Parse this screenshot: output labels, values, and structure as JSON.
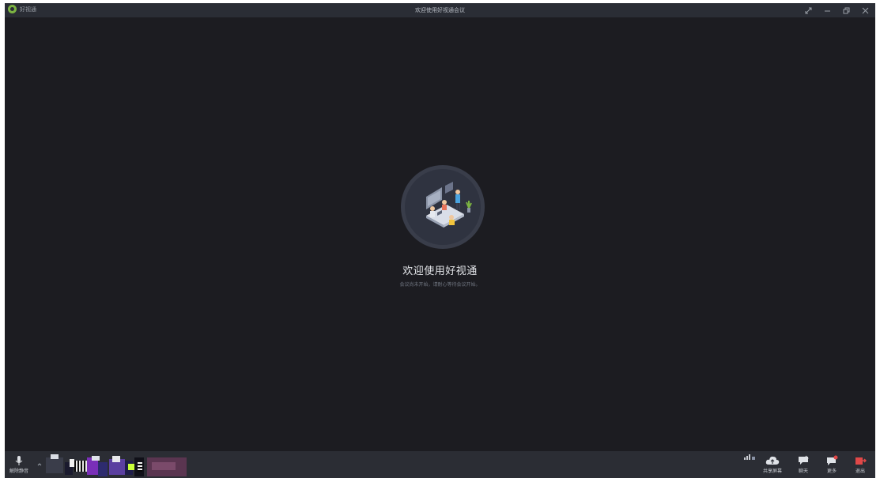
{
  "window": {
    "app_name": "好视通",
    "title": "欢迎使用好视通会议"
  },
  "welcome": {
    "title": "欢迎使用好视通",
    "subtitle": "会议尚未开始，请耐心等待会议开始。"
  },
  "toolbar": {
    "left": [
      {
        "label": "解除静音",
        "icon": "microphone-icon"
      }
    ],
    "right": [
      {
        "label": "共享屏幕",
        "icon": "share-screen-icon"
      },
      {
        "label": "聊天",
        "icon": "chat-icon"
      },
      {
        "label": "更多",
        "icon": "more-icon"
      },
      {
        "label": "退出",
        "icon": "exit-icon"
      }
    ]
  },
  "colors": {
    "background": "#1c1c21",
    "titlebar": "#2a2d35",
    "toolbar": "#2b2d34",
    "exit_red": "#e04848",
    "brand_green": "#7cb342"
  }
}
